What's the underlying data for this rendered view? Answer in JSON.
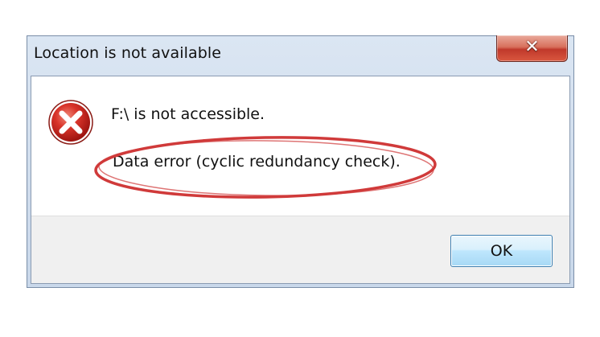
{
  "dialog": {
    "title": "Location is not available",
    "close_glyph": "✕",
    "message": "F:\\ is not accessible.",
    "detail": "Data error (cyclic redundancy check).",
    "ok_label": "OK",
    "icon": "error-icon"
  },
  "colors": {
    "title_bar": "#d3dfee",
    "close_button": "#c0392b",
    "error_icon": "#c8231b",
    "highlight_circle": "#d03a3a",
    "footer": "#f0f0f0",
    "ok_button": "#bee6fd"
  }
}
